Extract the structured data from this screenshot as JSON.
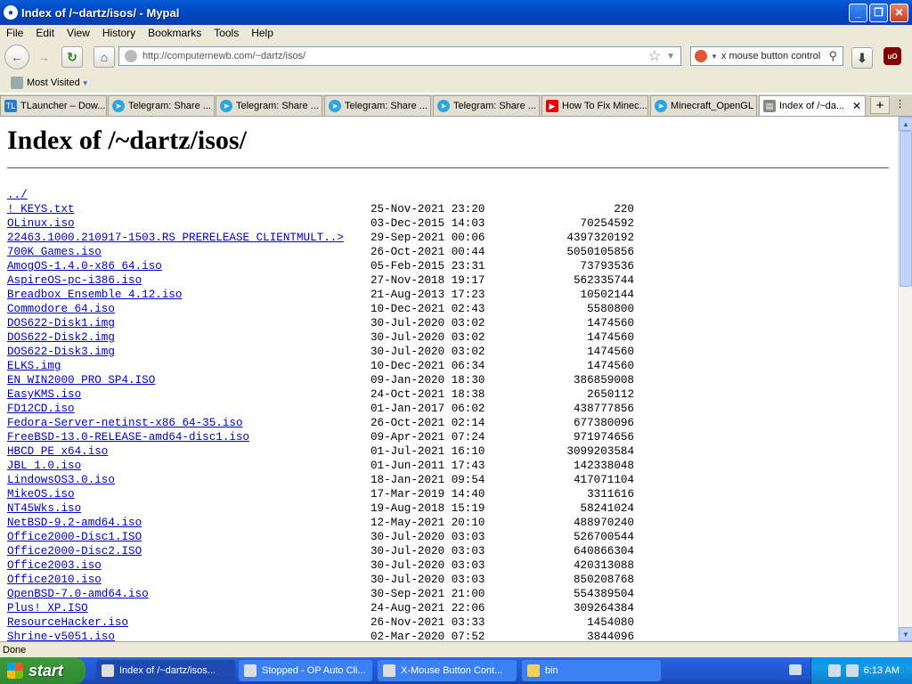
{
  "window": {
    "title": "Index of /~dartz/isos/ - Mypal"
  },
  "menu": [
    "File",
    "Edit",
    "View",
    "History",
    "Bookmarks",
    "Tools",
    "Help"
  ],
  "nav": {
    "url": "http://computernewb.com/~dartz/isos/",
    "search_query": "x mouse button control"
  },
  "bookmarks": {
    "most_visited": "Most Visited"
  },
  "tabs": [
    {
      "label": "TLauncher – Dow...",
      "icon": "tlauncher-icon"
    },
    {
      "label": "Telegram: Share ...",
      "icon": "telegram-icon"
    },
    {
      "label": "Telegram: Share ...",
      "icon": "telegram-icon"
    },
    {
      "label": "Telegram: Share ...",
      "icon": "telegram-icon"
    },
    {
      "label": "Telegram: Share ...",
      "icon": "telegram-icon"
    },
    {
      "label": "How To Fix Minec...",
      "icon": "youtube-icon"
    },
    {
      "label": "Minecraft_OpenGL",
      "icon": "telegram-icon"
    },
    {
      "label": "Index of /~da...",
      "icon": "page-icon",
      "active": true
    }
  ],
  "page": {
    "heading": "Index of /~dartz/isos/",
    "parent_link": "../",
    "entries": [
      {
        "name": "! KEYS.txt",
        "date": "25-Nov-2021 23:20",
        "size": "220"
      },
      {
        "name": "OLinux.iso",
        "date": "03-Dec-2015 14:03",
        "size": "70254592"
      },
      {
        "name": "22463.1000.210917-1503.RS PRERELEASE CLIENTMULT..>",
        "date": "29-Sep-2021 00:06",
        "size": "4397320192"
      },
      {
        "name": "700K Games.iso",
        "date": "26-Oct-2021 00:44",
        "size": "5050105856"
      },
      {
        "name": "AmogOS-1.4.0-x86 64.iso",
        "date": "05-Feb-2015 23:31",
        "size": "73793536"
      },
      {
        "name": "AspireOS-pc-i386.iso",
        "date": "27-Nov-2018 19:17",
        "size": "562335744"
      },
      {
        "name": "Breadbox Ensemble 4.12.iso",
        "date": "21-Aug-2013 17:23",
        "size": "10502144"
      },
      {
        "name": "Commodore 64.iso",
        "date": "10-Dec-2021 02:43",
        "size": "5580800"
      },
      {
        "name": "DOS622-Disk1.img",
        "date": "30-Jul-2020 03:02",
        "size": "1474560"
      },
      {
        "name": "DOS622-Disk2.img",
        "date": "30-Jul-2020 03:02",
        "size": "1474560"
      },
      {
        "name": "DOS622-Disk3.img",
        "date": "30-Jul-2020 03:02",
        "size": "1474560"
      },
      {
        "name": "ELKS.img",
        "date": "10-Dec-2021 06:34",
        "size": "1474560"
      },
      {
        "name": "EN WIN2000 PRO SP4.ISO",
        "date": "09-Jan-2020 18:30",
        "size": "386859008"
      },
      {
        "name": "EasyKMS.iso",
        "date": "24-Oct-2021 18:38",
        "size": "2650112"
      },
      {
        "name": "FD12CD.iso",
        "date": "01-Jan-2017 06:02",
        "size": "438777856"
      },
      {
        "name": "Fedora-Server-netinst-x86 64-35.iso",
        "date": "26-Oct-2021 02:14",
        "size": "677380096"
      },
      {
        "name": "FreeBSD-13.0-RELEASE-amd64-disc1.iso",
        "date": "09-Apr-2021 07:24",
        "size": "971974656"
      },
      {
        "name": "HBCD PE x64.iso",
        "date": "01-Jul-2021 16:10",
        "size": "3099203584"
      },
      {
        "name": "JBL 1.0.iso",
        "date": "01-Jun-2011 17:43",
        "size": "142338048"
      },
      {
        "name": "LindowsOS3.0.iso",
        "date": "18-Jan-2021 09:54",
        "size": "417071104"
      },
      {
        "name": "MikeOS.iso",
        "date": "17-Mar-2019 14:40",
        "size": "3311616"
      },
      {
        "name": "NT45Wks.iso",
        "date": "19-Aug-2018 15:19",
        "size": "58241024"
      },
      {
        "name": "NetBSD-9.2-amd64.iso",
        "date": "12-May-2021 20:10",
        "size": "488970240"
      },
      {
        "name": "Office2000-Disc1.ISO",
        "date": "30-Jul-2020 03:03",
        "size": "526700544"
      },
      {
        "name": "Office2000-Disc2.ISO",
        "date": "30-Jul-2020 03:03",
        "size": "640866304"
      },
      {
        "name": "Office2003.iso",
        "date": "30-Jul-2020 03:03",
        "size": "420313088"
      },
      {
        "name": "Office2010.iso",
        "date": "30-Jul-2020 03:03",
        "size": "850208768"
      },
      {
        "name": "OpenBSD-7.0-amd64.iso",
        "date": "30-Sep-2021 21:00",
        "size": "554389504"
      },
      {
        "name": "Plus! XP.ISO",
        "date": "24-Aug-2021 22:06",
        "size": "309264384"
      },
      {
        "name": "ResourceHacker.iso",
        "date": "26-Nov-2021 03:33",
        "size": "1454080"
      },
      {
        "name": "Shrine-v5051.iso",
        "date": "02-Mar-2020 07:52",
        "size": "3844096"
      }
    ]
  },
  "status": "Done",
  "taskbar": {
    "start_label": "start",
    "tasks": [
      {
        "label": "Index of /~dartz/isos...",
        "active": true
      },
      {
        "label": "Stopped - OP Auto Cli...",
        "active": false
      },
      {
        "label": "X-Mouse Button Cont...",
        "active": false
      },
      {
        "label": "bin",
        "active": false
      }
    ],
    "clock": "6:13 AM"
  }
}
